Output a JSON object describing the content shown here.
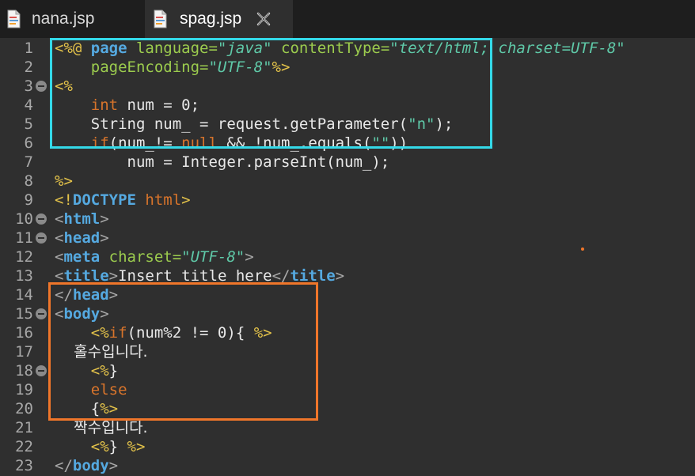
{
  "tabs": [
    {
      "label": "nana.jsp",
      "active": false
    },
    {
      "label": "spag.jsp",
      "active": true
    }
  ],
  "colors": {
    "highlight_box_1": "#34d9e8",
    "highlight_box_2": "#f0762a",
    "background": "#2f2f2f"
  },
  "lines": [
    {
      "n": "1",
      "t": [
        [
          "<%@ ",
          "jsp"
        ],
        [
          "page ",
          "dir"
        ],
        [
          "language=",
          "attr"
        ],
        [
          "\"java\"",
          "val"
        ],
        [
          " contentType=",
          "attr"
        ],
        [
          "\"text/html; charset=UTF-8\"",
          "val"
        ]
      ]
    },
    {
      "n": "2",
      "t": [
        [
          "    pageEncoding=",
          "attr"
        ],
        [
          "\"UTF-8\"",
          "val"
        ],
        [
          "%>",
          "jsp"
        ]
      ]
    },
    {
      "n": "3",
      "fold": true,
      "t": [
        [
          "<%",
          "jsp"
        ]
      ]
    },
    {
      "n": "4",
      "t": [
        [
          "    ",
          ""
        ],
        [
          "int",
          "kw"
        ],
        [
          " num = 0;",
          ""
        ]
      ]
    },
    {
      "n": "5",
      "t": [
        [
          "    String num_ = request.getParameter(",
          ""
        ],
        [
          "\"n\"",
          "str"
        ],
        [
          ");",
          ""
        ]
      ]
    },
    {
      "n": "6",
      "t": [
        [
          "    ",
          ""
        ],
        [
          "if",
          "kw"
        ],
        [
          "(num_!= ",
          ""
        ],
        [
          "null",
          "kw"
        ],
        [
          " && !num_.equals(",
          ""
        ],
        [
          "\"\"",
          "str"
        ],
        [
          "))",
          ""
        ]
      ]
    },
    {
      "n": "7",
      "t": [
        [
          "        num = Integer.parseInt(num_);",
          ""
        ]
      ]
    },
    {
      "n": "8",
      "t": [
        [
          "%>",
          "jsp"
        ]
      ]
    },
    {
      "n": "9",
      "t": [
        [
          "<!",
          "jsp"
        ],
        [
          "DOCTYPE",
          "dir"
        ],
        [
          " html",
          "kw"
        ],
        [
          ">",
          "jsp"
        ]
      ]
    },
    {
      "n": "10",
      "fold": true,
      "t": [
        [
          "<",
          "br"
        ],
        [
          "html",
          "tag"
        ],
        [
          ">",
          "br"
        ]
      ]
    },
    {
      "n": "11",
      "fold": true,
      "t": [
        [
          "<",
          "br"
        ],
        [
          "head",
          "tag"
        ],
        [
          ">",
          "br"
        ]
      ]
    },
    {
      "n": "12",
      "t": [
        [
          "<",
          "br"
        ],
        [
          "meta",
          "tag"
        ],
        [
          " charset=",
          "attr"
        ],
        [
          "\"UTF-8\"",
          "val"
        ],
        [
          ">",
          "br"
        ]
      ]
    },
    {
      "n": "13",
      "t": [
        [
          "<",
          "br"
        ],
        [
          "title",
          "tag"
        ],
        [
          ">",
          "br"
        ],
        [
          "Insert title here",
          ""
        ],
        [
          "</",
          "br"
        ],
        [
          "title",
          "tag"
        ],
        [
          ">",
          "br"
        ]
      ]
    },
    {
      "n": "14",
      "t": [
        [
          "</",
          "br"
        ],
        [
          "head",
          "tag"
        ],
        [
          ">",
          "br"
        ]
      ]
    },
    {
      "n": "15",
      "fold": true,
      "t": [
        [
          "<",
          "br"
        ],
        [
          "body",
          "tag"
        ],
        [
          ">",
          "br"
        ]
      ]
    },
    {
      "n": "16",
      "t": [
        [
          "    ",
          ""
        ],
        [
          "<%",
          "jsp"
        ],
        [
          "if",
          "kw"
        ],
        [
          "(num%2 != 0){ ",
          ""
        ],
        [
          "%>",
          "jsp"
        ]
      ]
    },
    {
      "n": "17",
      "t": [
        [
          "    홀수입니다.",
          "kor"
        ]
      ]
    },
    {
      "n": "18",
      "fold": true,
      "t": [
        [
          "    ",
          ""
        ],
        [
          "<%",
          "jsp"
        ],
        [
          "}",
          ""
        ]
      ]
    },
    {
      "n": "19",
      "t": [
        [
          "    ",
          ""
        ],
        [
          "else",
          "kw"
        ]
      ]
    },
    {
      "n": "20",
      "t": [
        [
          "    {",
          ""
        ],
        [
          "%>",
          "jsp"
        ]
      ]
    },
    {
      "n": "21",
      "t": [
        [
          "    짝수입니다.",
          "kor"
        ]
      ]
    },
    {
      "n": "22",
      "t": [
        [
          "    ",
          ""
        ],
        [
          "<%",
          "jsp"
        ],
        [
          "} ",
          ""
        ],
        [
          "%>",
          "jsp"
        ]
      ]
    },
    {
      "n": "23",
      "t": [
        [
          "</",
          "br"
        ],
        [
          "body",
          "tag"
        ],
        [
          ">",
          "br"
        ]
      ]
    }
  ]
}
